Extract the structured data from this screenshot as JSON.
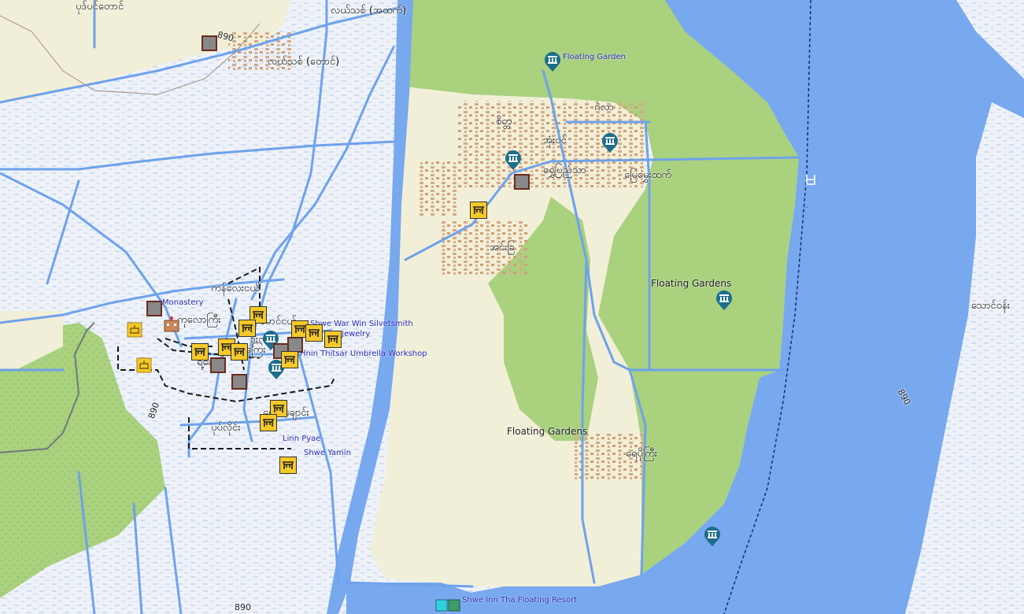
{
  "map": {
    "colors": {
      "water": "#78a8ee",
      "marsh": "#eef2f8",
      "farmland": "#f2efd8",
      "green": "#a9d17e",
      "road": "#6ea2ec",
      "buildings": "#d4aa86",
      "track": "#1a1a1a"
    },
    "places": [
      {
        "name": "ပုဒ်ပင်တောင်"
      },
      {
        "name": "လယ်သစ် (အထက်)"
      },
      {
        "name": "လယ်သစ် (တောင်)"
      },
      {
        "name": "ဂဲလာ"
      },
      {
        "name": "စိတ္တ"
      },
      {
        "name": "အုံးပင်"
      },
      {
        "name": "ရွှေပြည်သာ"
      },
      {
        "name": "မြေမွှေးထက်"
      },
      {
        "name": "အင်းခြ"
      },
      {
        "name": "ကန်လေးငယ်"
      },
      {
        "name": "ကုလောကြီး"
      },
      {
        "name": "မောင်ငယ်"
      },
      {
        "name": "ဒုံးလယ်"
      },
      {
        "name": "ကြေး"
      },
      {
        "name": "ရဲ့ချောင်"
      },
      {
        "name": "ပွောင်ချောင်း"
      },
      {
        "name": "ပုပ်လိုင်း"
      },
      {
        "name": "ရေပိုကြီး"
      },
      {
        "name": "သောင်ဝန်း"
      }
    ],
    "pois": [
      {
        "name": "Floating Garden"
      },
      {
        "name": "Monastery"
      },
      {
        "name": "Shwe War Win Silvetsmith"
      },
      {
        "name": "Jewelry"
      },
      {
        "name": "Hnin Thitsar Umbrella Workshop"
      },
      {
        "name": "Linn Pyae"
      },
      {
        "name": "Shwe Yamin"
      },
      {
        "name": "Shwe Inn Tha Floating Resort"
      }
    ],
    "area_labels": [
      {
        "name": "Floating Gardens"
      },
      {
        "name": "Floating Gardens"
      }
    ],
    "road_refs": [
      "890",
      "890",
      "890",
      "890"
    ]
  }
}
